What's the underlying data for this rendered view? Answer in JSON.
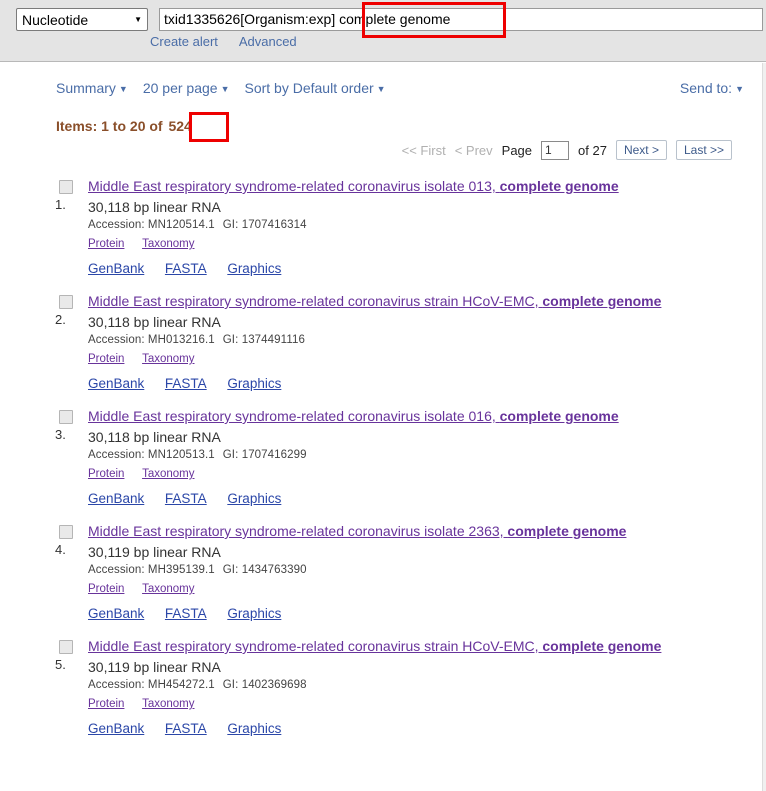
{
  "search": {
    "database_selected": "Nucleotide",
    "query_prefix": "txid1335626[Organism:exp] ",
    "query_highlight": "complete genome",
    "create_alert_label": "Create alert",
    "advanced_label": "Advanced"
  },
  "toolbar": {
    "display_format": "Summary",
    "per_page": "20 per page",
    "sort_by": "Sort by Default order",
    "send_to": "Send to:"
  },
  "results_summary": {
    "prefix": "Items: 1 to 20 of ",
    "total": "524"
  },
  "pagination": {
    "first_label": "<< First",
    "prev_label": "< Prev",
    "page_label": "Page",
    "page_value": "1",
    "of_label": "of 27",
    "next_label": "Next >",
    "last_label": "Last >>"
  },
  "item_links": {
    "protein": "Protein",
    "taxonomy": "Taxonomy",
    "genbank": "GenBank",
    "fasta": "FASTA",
    "graphics": "Graphics"
  },
  "results": [
    {
      "number": "1.",
      "title_main": "Middle East respiratory syndrome-related coronavirus isolate 013, ",
      "title_bold": "complete genome",
      "length": "30,118 bp linear RNA",
      "accession": "Accession: MN120514.1",
      "gi": "GI: 1707416314"
    },
    {
      "number": "2.",
      "title_main": "Middle East respiratory syndrome-related coronavirus strain HCoV-EMC, ",
      "title_bold": "complete genome",
      "length": "30,118 bp linear RNA",
      "accession": "Accession: MH013216.1",
      "gi": "GI: 1374491116"
    },
    {
      "number": "3.",
      "title_main": "Middle East respiratory syndrome-related coronavirus isolate 016, ",
      "title_bold": "complete genome",
      "length": "30,118 bp linear RNA",
      "accession": "Accession: MN120513.1",
      "gi": "GI: 1707416299"
    },
    {
      "number": "4.",
      "title_main": "Middle East respiratory syndrome-related coronavirus isolate 2363, ",
      "title_bold": "complete genome",
      "length": "30,119 bp linear RNA",
      "accession": "Accession: MH395139.1",
      "gi": "GI: 1434763390"
    },
    {
      "number": "5.",
      "title_main": "Middle East respiratory syndrome-related coronavirus strain HCoV-EMC, ",
      "title_bold": "complete genome",
      "length": "30,119 bp linear RNA",
      "accession": "Accession: MH454272.1",
      "gi": "GI: 1402369698"
    }
  ],
  "colors": {
    "annotation_red": "#ee0000",
    "header_band": "#e4e4e4",
    "link_blue": "#2b47a8",
    "link_visited_purple": "#68339b",
    "nav_blue": "#4a6da7",
    "items_brown": "#8a4f2a"
  }
}
